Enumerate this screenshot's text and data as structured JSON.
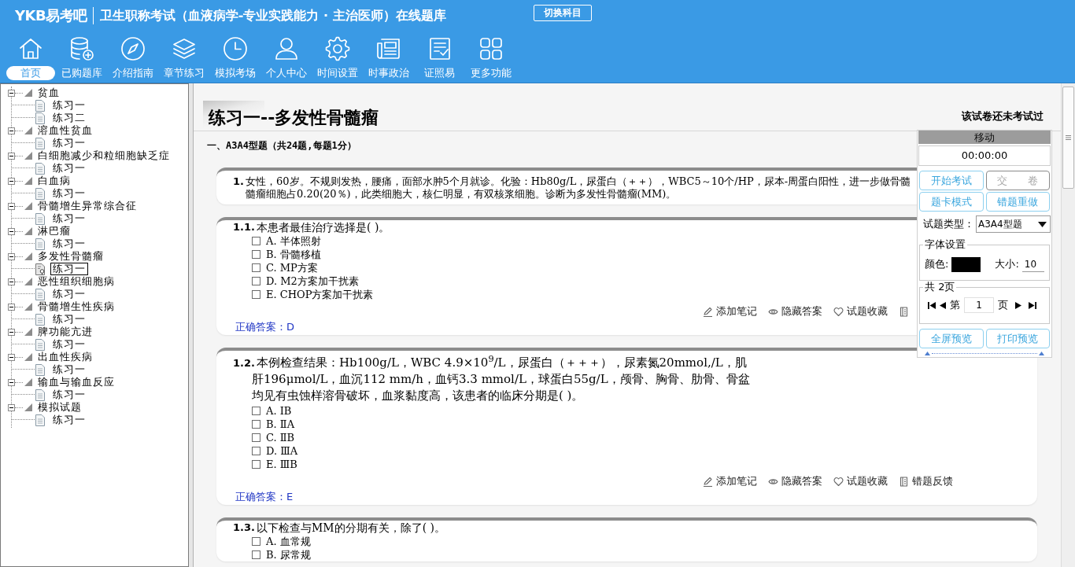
{
  "header": {
    "logo": "YKB易考吧",
    "title": "卫生职称考试（血液病学-专业实践能力 · 主治医师）在线题库",
    "switch_button": "切换科目"
  },
  "nav": [
    {
      "label": "首页",
      "selected": true
    },
    {
      "label": "已购题库",
      "selected": false
    },
    {
      "label": "介绍指南",
      "selected": false
    },
    {
      "label": "章节练习",
      "selected": false
    },
    {
      "label": "模拟考场",
      "selected": false
    },
    {
      "label": "个人中心",
      "selected": false
    },
    {
      "label": "时间设置",
      "selected": false
    },
    {
      "label": "时事政治",
      "selected": false
    },
    {
      "label": "证照易",
      "selected": false
    },
    {
      "label": "更多功能",
      "selected": false
    }
  ],
  "tree": [
    {
      "label": "贫血",
      "expanded": true,
      "children": [
        {
          "label": "练习一",
          "selected": false
        },
        {
          "label": "练习二",
          "selected": false
        }
      ]
    },
    {
      "label": "溶血性贫血",
      "expanded": true,
      "children": [
        {
          "label": "练习一",
          "selected": false
        }
      ]
    },
    {
      "label": "白细胞减少和粒细胞缺乏症",
      "expanded": true,
      "children": [
        {
          "label": "练习一",
          "selected": false
        }
      ]
    },
    {
      "label": "白血病",
      "expanded": true,
      "children": [
        {
          "label": "练习一",
          "selected": false
        }
      ]
    },
    {
      "label": "骨髓增生异常综合征",
      "expanded": true,
      "children": [
        {
          "label": "练习一",
          "selected": false
        }
      ]
    },
    {
      "label": "淋巴瘤",
      "expanded": true,
      "children": [
        {
          "label": "练习一",
          "selected": false
        }
      ]
    },
    {
      "label": "多发性骨髓瘤",
      "expanded": true,
      "children": [
        {
          "label": "练习一",
          "selected": true
        }
      ]
    },
    {
      "label": "恶性组织细胞病",
      "expanded": true,
      "children": [
        {
          "label": "练习一",
          "selected": false
        }
      ]
    },
    {
      "label": "骨髓增生性疾病",
      "expanded": true,
      "children": [
        {
          "label": "练习一",
          "selected": false
        }
      ]
    },
    {
      "label": "脾功能亢进",
      "expanded": true,
      "children": [
        {
          "label": "练习一",
          "selected": false
        }
      ]
    },
    {
      "label": "出血性疾病",
      "expanded": true,
      "children": [
        {
          "label": "练习一",
          "selected": false
        }
      ]
    },
    {
      "label": "输血与输血反应",
      "expanded": true,
      "children": [
        {
          "label": "练习一",
          "selected": false
        }
      ]
    },
    {
      "label": "模拟试题",
      "expanded": true,
      "children": [
        {
          "label": "练习一",
          "selected": false
        }
      ]
    }
  ],
  "paper": {
    "title": "练习一--多发性骨髓瘤",
    "status": "该试卷还未考试过",
    "section": "一、A3A4型题（共24题,每题1分）"
  },
  "stem": {
    "number": "1.",
    "lines": [
      "女性，60岁。不规则发热，腰痛，面部水肿5个月就诊。化验：Hb80g/L，尿蛋白（＋＋），WBC5～10个/HP，尿本-周蛋白阳性，进一步做骨髓",
      "髓瘤细胞占0.20(20％)，此类细胞大，核仁明显，有双核浆细胞。诊断为多发性骨髓瘤(MM)。"
    ]
  },
  "questions": [
    {
      "number": "1.1.",
      "text": "本患者最佳治疗选择是( )。",
      "options": [
        {
          "text": "A. 半体照射",
          "checked": false
        },
        {
          "text": "B. 骨髓移植",
          "checked": false
        },
        {
          "text": "C. MP方案",
          "checked": false
        },
        {
          "text": "D. M2方案加干扰素",
          "checked": false
        },
        {
          "text": "E. CHOP方案加干扰素",
          "checked": false
        }
      ],
      "actions": [
        {
          "kind": "note",
          "label": "添加笔记"
        },
        {
          "kind": "hide",
          "label": "隐藏答案"
        },
        {
          "kind": "favorite",
          "label": "试题收藏"
        },
        {
          "kind": "feedback"
        }
      ],
      "answer": "正确答案：D"
    },
    {
      "number": "1.2.",
      "lines": [
        "本例检查结果：Hb100g/L，WBC 4.9×10$^{9}$/L，尿蛋白（＋＋＋），尿素氮20mmol,/L，肌",
        "肝196μmol/L，血沉112 mm/h，血钙3.3 mmol/L，球蛋白55g/L，颅骨、胸骨、肋骨、骨盆",
        "均见有虫蚀样溶骨破坏，血浆黏度高，该患者的临床分期是( )。"
      ],
      "options": [
        {
          "text": "A. ⅠB",
          "checked": false
        },
        {
          "text": "B. ⅡA",
          "checked": false
        },
        {
          "text": "C. ⅡB",
          "checked": false
        },
        {
          "text": "D. ⅢA",
          "checked": false
        },
        {
          "text": "E. ⅢB",
          "checked": false
        }
      ],
      "actions": [
        {
          "kind": "note",
          "label": "添加笔记"
        },
        {
          "kind": "hide",
          "label": "隐藏答案"
        },
        {
          "kind": "favorite",
          "label": "试题收藏"
        },
        {
          "kind": "feedback",
          "label": "错题反馈"
        }
      ],
      "answer": "正确答案：E"
    },
    {
      "number": "1.3.",
      "text": "以下检查与MM的分期有关，除了( )。",
      "options": [
        {
          "text": "A. 血常规",
          "checked": false
        },
        {
          "text": "B. 尿常规",
          "checked": false
        }
      ]
    }
  ],
  "panel": {
    "title": "移动",
    "timer": "00:00:00",
    "buttons": [
      {
        "label": "开始考试",
        "disabled": false
      },
      {
        "label": "交　　卷",
        "disabled": true
      },
      {
        "label": "题卡模式",
        "disabled": false
      },
      {
        "label": "错题重做",
        "disabled": false
      }
    ],
    "type_label": "试题类型：",
    "type_value": "A3A4型题",
    "font_legend": "字体设置",
    "color_label": "颜色:",
    "size_label": "大小:",
    "size_value": "10",
    "pages_legend": "共 2页",
    "page_prefix": "第",
    "page_value": "1",
    "page_suffix": "页",
    "bottom_buttons": [
      "全屏预览",
      "打印预览"
    ]
  }
}
